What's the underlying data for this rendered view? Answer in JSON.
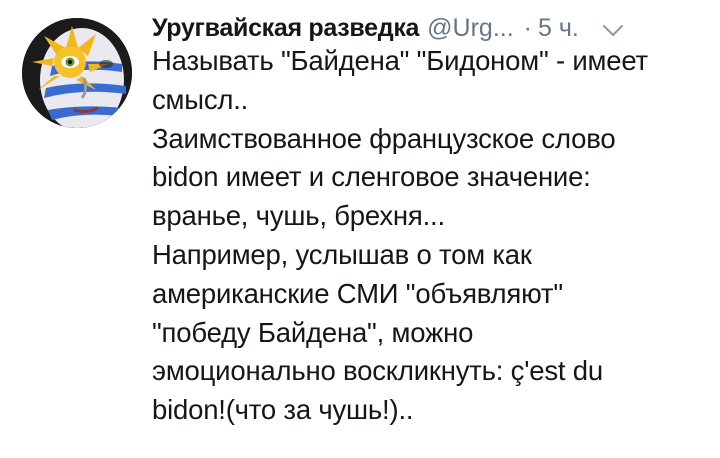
{
  "tweet": {
    "author_name": "Уругвайская разведка",
    "author_handle": "@Urg...",
    "separator": "·",
    "timestamp": "5 ч.",
    "text_lines": [
      "Называть \"Байдена\" \"Бидоном\" - имеет",
      "смысл..",
      "Заимствованное французское слово",
      "bidon имеет и сленговое значение:",
      "вранье, чушь, брехня...",
      "Например, услышав о том как",
      "американские СМИ \"объявляют\"",
      "\"победу Байдена\", можно",
      "эмоционально воскликнуть: ç'est du",
      "bidon!(что за чушь!).."
    ]
  },
  "icons": {
    "avatar": "avatar-face-uruguay-flag",
    "menu": "chevron-down-icon"
  },
  "colors": {
    "text": "#14171a",
    "secondary": "#657786",
    "flag_blue": "#3a6bd0",
    "sun_yellow": "#f2b51a"
  }
}
